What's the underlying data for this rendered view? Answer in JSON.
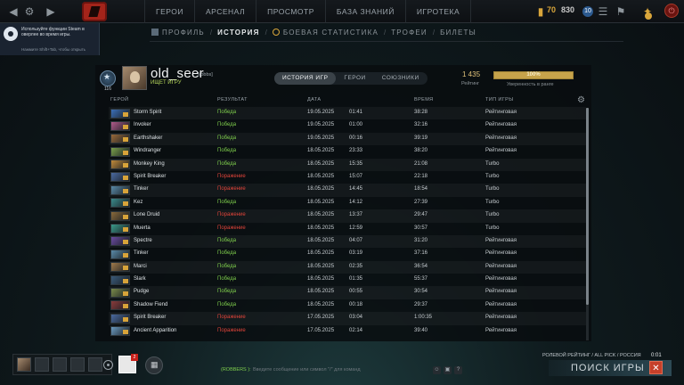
{
  "top_nav": {
    "items": [
      "ГЕРОИ",
      "АРСЕНАЛ",
      "ПРОСМОТР",
      "БАЗА ЗНАНИЙ",
      "ИГРОТЕКА"
    ],
    "gold_amount": "70",
    "shards_amount": "830",
    "level_badge": "10"
  },
  "steam_overlay": {
    "message": "Используйте функции Steam в оверлее во время игры.",
    "hint": "Нажмите Shift+Tab, чтобы открыть"
  },
  "profile_tabs": [
    "ПРОФИЛЬ",
    "ИСТОРИЯ",
    "БОЕВАЯ СТАТИСТИКА",
    "ТРОФЕИ",
    "БИЛЕТЫ"
  ],
  "player": {
    "name": "old_seer",
    "tag": "[robbs]",
    "status": "ИЩЕТ ИГРУ",
    "rank_number": "116",
    "rating": "1 435",
    "rating_label": "Рейтинг",
    "confidence_value": 100,
    "confidence_text": "100%",
    "confidence_label": "Уверенность в ранге"
  },
  "history_tabs": [
    "ИСТОРИЯ ИГР",
    "ГЕРОИ",
    "СОЮЗНИКИ"
  ],
  "table": {
    "headers": {
      "hero": "ГЕРОЙ",
      "result": "РЕЗУЛЬТАТ",
      "date": "ДАТА",
      "duration": "ВРЕМЯ",
      "mode": "ТИП ИГРЫ"
    },
    "rows": [
      {
        "hero": "Storm Spirit",
        "result": "Победа",
        "win": true,
        "date": "19.05.2025",
        "time": "01:41",
        "duration": "38:28",
        "mode": "Рейтинговая",
        "color": "#3b6fb8"
      },
      {
        "hero": "Invoker",
        "result": "Победа",
        "win": true,
        "date": "19.05.2025",
        "time": "01:00",
        "duration": "32:16",
        "mode": "Рейтинговая",
        "color": "#b05a8a"
      },
      {
        "hero": "Earthshaker",
        "result": "Победа",
        "win": true,
        "date": "19.05.2025",
        "time": "00:16",
        "duration": "39:19",
        "mode": "Рейтинговая",
        "color": "#9a6a3a"
      },
      {
        "hero": "Windranger",
        "result": "Победа",
        "win": true,
        "date": "18.05.2025",
        "time": "23:33",
        "duration": "38:20",
        "mode": "Рейтинговая",
        "color": "#7aa04a"
      },
      {
        "hero": "Monkey King",
        "result": "Победа",
        "win": true,
        "date": "18.05.2025",
        "time": "15:35",
        "duration": "21:08",
        "mode": "Turbo",
        "color": "#c08a3a"
      },
      {
        "hero": "Spirit Breaker",
        "result": "Поражение",
        "win": false,
        "date": "18.05.2025",
        "time": "15:07",
        "duration": "22:18",
        "mode": "Turbo",
        "color": "#4a6aa0"
      },
      {
        "hero": "Tinker",
        "result": "Поражение",
        "win": false,
        "date": "18.05.2025",
        "time": "14:45",
        "duration": "18:54",
        "mode": "Turbo",
        "color": "#5a8aa8"
      },
      {
        "hero": "Kez",
        "result": "Победа",
        "win": true,
        "date": "18.05.2025",
        "time": "14:12",
        "duration": "27:39",
        "mode": "Turbo",
        "color": "#3a8a8a"
      },
      {
        "hero": "Lone Druid",
        "result": "Поражение",
        "win": false,
        "date": "18.05.2025",
        "time": "13:37",
        "duration": "29:47",
        "mode": "Turbo",
        "color": "#8a6a3a"
      },
      {
        "hero": "Muerta",
        "result": "Поражение",
        "win": false,
        "date": "18.05.2025",
        "time": "12:59",
        "duration": "30:57",
        "mode": "Turbo",
        "color": "#3a9a8a"
      },
      {
        "hero": "Spectre",
        "result": "Победа",
        "win": true,
        "date": "18.05.2025",
        "time": "04:07",
        "duration": "31:20",
        "mode": "Рейтинговая",
        "color": "#6a4aa0"
      },
      {
        "hero": "Tinker",
        "result": "Победа",
        "win": true,
        "date": "18.05.2025",
        "time": "03:19",
        "duration": "37:16",
        "mode": "Рейтинговая",
        "color": "#5a8aa8"
      },
      {
        "hero": "Marci",
        "result": "Победа",
        "win": true,
        "date": "18.05.2025",
        "time": "02:35",
        "duration": "36:54",
        "mode": "Рейтинговая",
        "color": "#a07a4a"
      },
      {
        "hero": "Slark",
        "result": "Победа",
        "win": true,
        "date": "18.05.2025",
        "time": "01:35",
        "duration": "55:37",
        "mode": "Рейтинговая",
        "color": "#3a5a7a"
      },
      {
        "hero": "Pudge",
        "result": "Победа",
        "win": true,
        "date": "18.05.2025",
        "time": "00:55",
        "duration": "30:54",
        "mode": "Рейтинговая",
        "color": "#7a8a4a"
      },
      {
        "hero": "Shadow Fiend",
        "result": "Победа",
        "win": true,
        "date": "18.05.2025",
        "time": "00:18",
        "duration": "29:37",
        "mode": "Рейтинговая",
        "color": "#8a3a3a"
      },
      {
        "hero": "Spirit Breaker",
        "result": "Поражение",
        "win": false,
        "date": "17.05.2025",
        "time": "03:04",
        "duration": "1:00:35",
        "mode": "Рейтинговая",
        "color": "#4a6aa0"
      },
      {
        "hero": "Ancient Apparition",
        "result": "Поражение",
        "win": false,
        "date": "17.05.2025",
        "time": "02:14",
        "duration": "39:40",
        "mode": "Рейтинговая",
        "color": "#6a9ac0"
      }
    ]
  },
  "bottom": {
    "inventory_count": "2",
    "chat_channel": "(ROBBERS ):",
    "chat_placeholder": "Введите сообщение или символ \"/\" для команд",
    "queue_info": "РОЛЕВОЙ РЕЙТИНГ / ALL PICK / РОССИЯ",
    "queue_timer": "0:01",
    "search_label": "ПОИСК ИГРЫ"
  },
  "colors": {
    "win": "#7fcf4c",
    "loss": "#e0443a",
    "accent_gold": "#c6a34b"
  }
}
